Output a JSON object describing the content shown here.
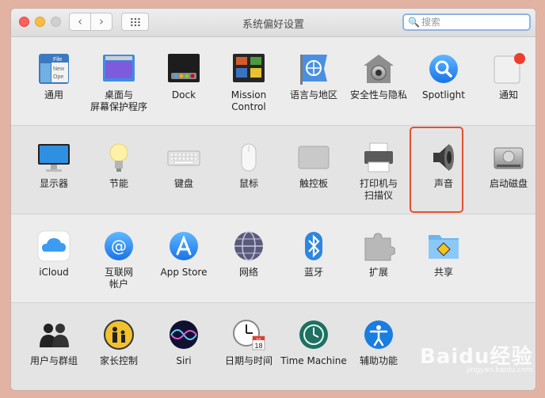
{
  "window": {
    "title": "系统偏好设置",
    "search_placeholder": "搜索",
    "back_symbol": "‹",
    "forward_symbol": "›",
    "search_icon_glyph": "🔍"
  },
  "rows": [
    {
      "items": [
        {
          "label": "通用",
          "icon": "general-icon"
        },
        {
          "label": "桌面与\n屏幕保护程序",
          "icon": "desktop-screensaver-icon"
        },
        {
          "label": "Dock",
          "icon": "dock-icon"
        },
        {
          "label": "Mission\nControl",
          "icon": "mission-control-icon"
        },
        {
          "label": "语言与地区",
          "icon": "language-region-icon"
        },
        {
          "label": "安全性与隐私",
          "icon": "security-privacy-icon"
        },
        {
          "label": "Spotlight",
          "icon": "spotlight-icon"
        },
        {
          "label": "通知",
          "icon": "notifications-icon"
        }
      ]
    },
    {
      "items": [
        {
          "label": "显示器",
          "icon": "displays-icon"
        },
        {
          "label": "节能",
          "icon": "energy-saver-icon"
        },
        {
          "label": "键盘",
          "icon": "keyboard-icon"
        },
        {
          "label": "鼠标",
          "icon": "mouse-icon"
        },
        {
          "label": "触控板",
          "icon": "trackpad-icon"
        },
        {
          "label": "打印机与\n扫描仪",
          "icon": "printers-scanners-icon"
        },
        {
          "label": "声音",
          "icon": "sound-icon"
        },
        {
          "label": "启动磁盘",
          "icon": "startup-disk-icon"
        }
      ]
    },
    {
      "items": [
        {
          "label": "iCloud",
          "icon": "icloud-icon"
        },
        {
          "label": "互联网\n帐户",
          "icon": "internet-accounts-icon"
        },
        {
          "label": "App Store",
          "icon": "app-store-icon"
        },
        {
          "label": "网络",
          "icon": "network-icon"
        },
        {
          "label": "蓝牙",
          "icon": "bluetooth-icon"
        },
        {
          "label": "扩展",
          "icon": "extensions-icon"
        },
        {
          "label": "共享",
          "icon": "sharing-icon"
        }
      ]
    },
    {
      "items": [
        {
          "label": "用户与群组",
          "icon": "users-groups-icon"
        },
        {
          "label": "家长控制",
          "icon": "parental-controls-icon"
        },
        {
          "label": "Siri",
          "icon": "siri-icon"
        },
        {
          "label": "日期与时间",
          "icon": "date-time-icon"
        },
        {
          "label": "Time Machine",
          "icon": "time-machine-icon"
        },
        {
          "label": "辅助功能",
          "icon": "accessibility-icon"
        }
      ]
    }
  ],
  "icon_texts": {
    "general": [
      "File",
      "New",
      "Ope"
    ],
    "calendar_month": "JUL",
    "calendar_day": "18"
  },
  "highlighted_item": "声音",
  "watermark": {
    "text": "Baidu经验",
    "subtext": "jingyan.baidu.com"
  }
}
